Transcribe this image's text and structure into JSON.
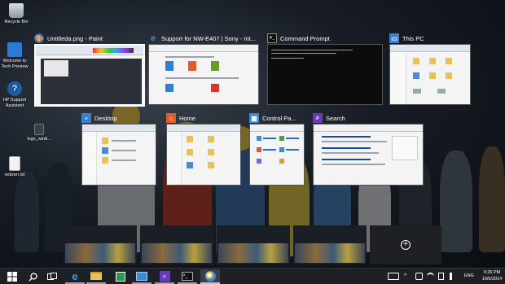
{
  "desktop_icons": [
    {
      "label": "Recycle Bin",
      "icon": "recycle-bin-icon"
    },
    {
      "label": "Welcome to Tech Preview",
      "icon": "welcome-icon"
    },
    {
      "label": "HP Support Assistant",
      "icon": "help-icon"
    },
    {
      "label": "logo_win8...",
      "icon": "image-file-icon"
    },
    {
      "label": "notizen.txt",
      "icon": "text-file-icon"
    }
  ],
  "windows": [
    {
      "id": "paint",
      "title": "Untitleda.png - Paint",
      "icon": "paint-icon",
      "selected": true
    },
    {
      "id": "ie",
      "title": "Support for NW-E407 | Sony - Int...",
      "icon": "internet-explorer-icon",
      "selected": false
    },
    {
      "id": "cmd",
      "title": "Command Prompt",
      "icon": "command-prompt-icon",
      "selected": false
    },
    {
      "id": "thispc",
      "title": "This PC",
      "icon": "this-pc-icon",
      "selected": false
    },
    {
      "id": "desktop",
      "title": "Desktop",
      "icon": "folder-desktop-icon",
      "selected": false
    },
    {
      "id": "home",
      "title": "Home",
      "icon": "home-icon",
      "selected": false
    },
    {
      "id": "control",
      "title": "Control Pa...",
      "icon": "control-panel-icon",
      "selected": false
    },
    {
      "id": "search",
      "title": "Search",
      "icon": "search-app-icon",
      "selected": false
    }
  ],
  "virtual_desktops": {
    "count": 4,
    "new_desktop_icon": "add-desktop-icon"
  },
  "taskbar": {
    "buttons": [
      {
        "name": "start-button",
        "icon": "windows-logo-icon",
        "state": "normal"
      },
      {
        "name": "search-button",
        "icon": "search-icon",
        "state": "normal"
      },
      {
        "name": "task-view-button",
        "icon": "task-view-icon",
        "state": "normal"
      },
      {
        "name": "ie-button",
        "icon": "internet-explorer-icon",
        "state": "open"
      },
      {
        "name": "explorer-button",
        "icon": "file-explorer-icon",
        "state": "open"
      },
      {
        "name": "store-button",
        "icon": "store-icon",
        "state": "normal"
      },
      {
        "name": "control-panel-button",
        "icon": "control-panel-icon",
        "state": "open"
      },
      {
        "name": "search-app-button",
        "icon": "search-app-icon",
        "state": "open"
      },
      {
        "name": "cmd-button",
        "icon": "command-prompt-icon",
        "state": "open"
      },
      {
        "name": "paint-button",
        "icon": "paint-icon",
        "state": "active"
      }
    ],
    "tray_icons": [
      "keyboard-icon",
      "chevron-up-icon",
      "notification-icon",
      "network-icon",
      "battery-icon",
      "volume-icon"
    ],
    "language": "ENG",
    "time": "9:26 PM",
    "date": "10/5/2014"
  },
  "colors": {
    "accent": "#7aa7d8",
    "taskbar": "#1d2126",
    "selection_border": "#ffffff"
  }
}
